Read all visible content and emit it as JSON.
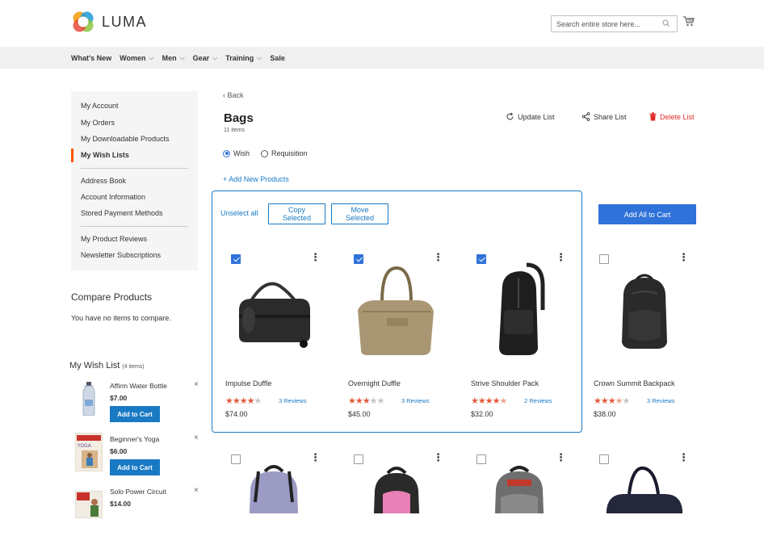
{
  "brand": {
    "name": "LUMA"
  },
  "search": {
    "placeholder": "Search entire store here..."
  },
  "nav": [
    {
      "label": "What's New",
      "dropdown": false
    },
    {
      "label": "Women",
      "dropdown": true
    },
    {
      "label": "Men",
      "dropdown": true
    },
    {
      "label": "Gear",
      "dropdown": true
    },
    {
      "label": "Training",
      "dropdown": true
    },
    {
      "label": "Sale",
      "dropdown": false
    }
  ],
  "sidebar": {
    "items": [
      {
        "label": "My Account"
      },
      {
        "label": "My Orders"
      },
      {
        "label": "My Downloadable Products"
      },
      {
        "label": "My Wish Lists",
        "active": true
      },
      {
        "label": "Address Book"
      },
      {
        "label": "Account Information"
      },
      {
        "label": "Stored Payment Methods"
      },
      {
        "label": "My Product Reviews"
      },
      {
        "label": "Newsletter Subscriptions"
      }
    ]
  },
  "compare": {
    "title": "Compare Products",
    "empty_text": "You have no items to compare."
  },
  "wishlist_widget": {
    "title": "My Wish List",
    "count": "(4 items)",
    "items": [
      {
        "name": "Affirm Water Bottle",
        "price": "$7.00",
        "button": "Add to Cart",
        "remove": "×"
      },
      {
        "name": "Beginner's Yoga",
        "price": "$6.00",
        "button": "Add to Cart",
        "remove": "×"
      },
      {
        "name": "Solo Power Circuit",
        "price": "$14.00",
        "remove": "×"
      }
    ]
  },
  "main": {
    "back": "Back",
    "title": "Bags",
    "count": "11 items",
    "actions": {
      "update": "Update List",
      "share": "Share List",
      "delete": "Delete List"
    },
    "type": {
      "wish": "Wish",
      "requisition": "Requisition",
      "selected": "wish"
    },
    "add_new": "+ Add New Products",
    "unselect_all": "Unselect all",
    "copy_selected": "Copy Selected",
    "move_selected": "Move Selected",
    "add_all": "Add All to Cart"
  },
  "products": [
    {
      "name": "Impulse Duffle",
      "rating": 4,
      "reviews": "3 Reviews",
      "price": "$74.00",
      "selected": true,
      "icon": "duffle-bag-icon"
    },
    {
      "name": "Overnight Duffle",
      "rating": 3,
      "reviews": "3 Reviews",
      "price": "$45.00",
      "selected": true,
      "icon": "tote-bag-icon"
    },
    {
      "name": "Strive Shoulder Pack",
      "rating": 4.5,
      "reviews": "2 Reviews",
      "price": "$32.00",
      "selected": true,
      "icon": "sling-pack-icon"
    },
    {
      "name": "Crown Summit Backpack",
      "rating": 3.5,
      "reviews": "3 Reviews",
      "price": "$38.00",
      "selected": false,
      "icon": "backpack-icon"
    },
    {
      "selected": false,
      "icon": "backpack-icon"
    },
    {
      "selected": false,
      "icon": "backpack-icon"
    },
    {
      "selected": false,
      "icon": "backpack-icon"
    },
    {
      "selected": false,
      "icon": "duffle-bag-icon"
    }
  ],
  "colors": {
    "accent": "#2f72d9",
    "link": "#1979c3",
    "star": "#e25b3b",
    "danger": "#e02b27",
    "nav_bg": "#f0f0f0",
    "sidebar_bg": "#f5f5f5",
    "sidebar_active": "#ff5501"
  }
}
